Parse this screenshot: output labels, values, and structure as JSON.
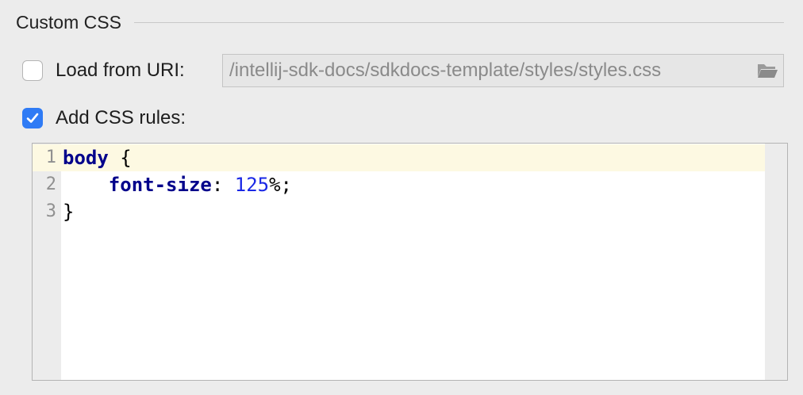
{
  "group": {
    "title": "Custom CSS"
  },
  "load_from_uri": {
    "checked": false,
    "label": "Load from URI:",
    "value": "/intellij-sdk-docs/sdkdocs-template/styles/styles.css",
    "browse_icon": "folder-open-icon"
  },
  "add_css_rules": {
    "checked": true,
    "label": "Add CSS rules:"
  },
  "editor": {
    "current_line": 1,
    "lines": [
      {
        "number": "1",
        "selector": "body",
        "open_brace": " {"
      },
      {
        "number": "2",
        "indent": "    ",
        "property": "font-size",
        "colon": ": ",
        "value": "125",
        "unit": "%;"
      },
      {
        "number": "3",
        "close_brace": "}"
      }
    ]
  },
  "colors": {
    "checkbox_checked": "#2f7bf5",
    "current_line_highlight": "#fdf9e2",
    "keyword": "#00008b",
    "number": "#1a28e6"
  }
}
